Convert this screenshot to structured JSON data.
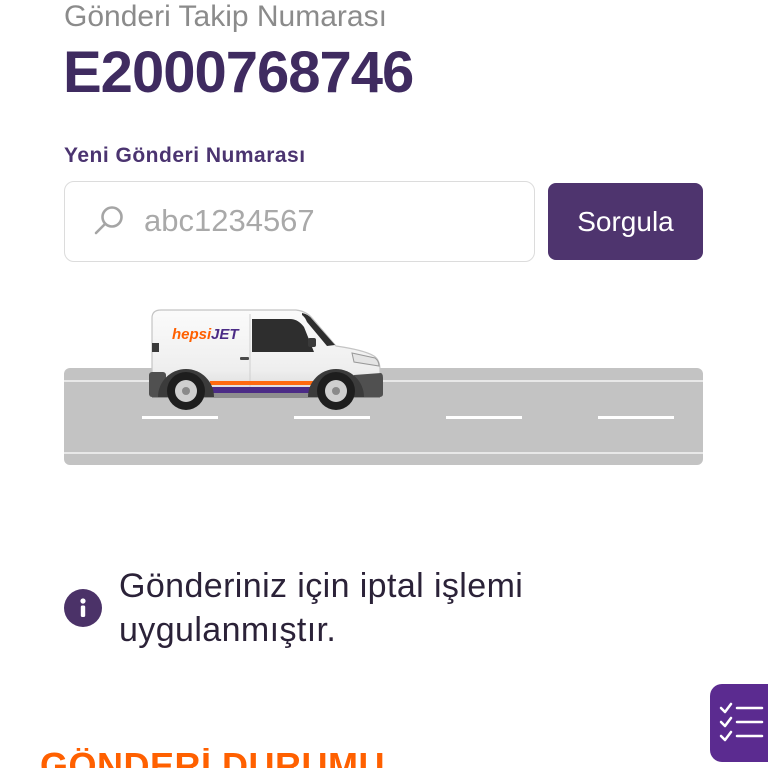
{
  "header": {
    "tracking_label": "Gönderi Takip Numarası",
    "tracking_number": "E2000768746"
  },
  "search": {
    "label": "Yeni Gönderi Numarası",
    "placeholder": "abc1234567",
    "icon": "search-icon",
    "button_label": "Sorgula"
  },
  "illustration": {
    "icon": "delivery-van",
    "van_logo_prefix": "hepsi",
    "van_logo_suffix": "JET"
  },
  "notice": {
    "icon": "info-icon",
    "message": "Gönderiniz için iptal işlemi uygulanmıştır."
  },
  "fab": {
    "icon": "checklist-icon"
  },
  "section": {
    "title": "GÖNDERİ DURUMU"
  },
  "colors": {
    "primary": "#4e346e",
    "tracking_number": "#3f2b60",
    "accent": "#ff6000",
    "fab": "#5b2b90",
    "muted_text": "#8b8b8b"
  }
}
